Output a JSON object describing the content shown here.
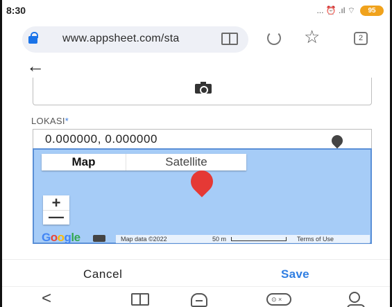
{
  "status_bar": {
    "time": "8:30",
    "indicators": "... ⏰ .ıl ⌔",
    "battery": "95"
  },
  "browser": {
    "url": "www.appsheet.com/sta",
    "tab_count": "2"
  },
  "form": {
    "location_label": "LOKASI",
    "required_mark": "*",
    "location_value": "0.000000, 0.000000"
  },
  "map": {
    "tab_map": "Map",
    "tab_satellite": "Satellite",
    "zoom_in": "+",
    "zoom_out": "—",
    "logo_letters": [
      "G",
      "o",
      "o",
      "g",
      "le"
    ],
    "map_data": "Map data ©2022",
    "scale": "50 m",
    "terms": "Terms of Use"
  },
  "actions": {
    "cancel": "Cancel",
    "save": "Save"
  },
  "nav": {
    "back": "<"
  },
  "colors": {
    "accent": "#2f7ee2",
    "map_water": "#a6ccf7",
    "marker": "#e53935",
    "battery": "#f0a21c"
  },
  "icons": [
    "lock-icon",
    "reader-mode-icon",
    "reload-icon",
    "star-icon",
    "tabs-icon",
    "back-arrow-icon",
    "camera-icon",
    "pin-icon",
    "map-marker-icon",
    "keyboard-icon",
    "nav-book-icon",
    "nav-home-icon",
    "nav-game-icon",
    "nav-user-icon"
  ]
}
